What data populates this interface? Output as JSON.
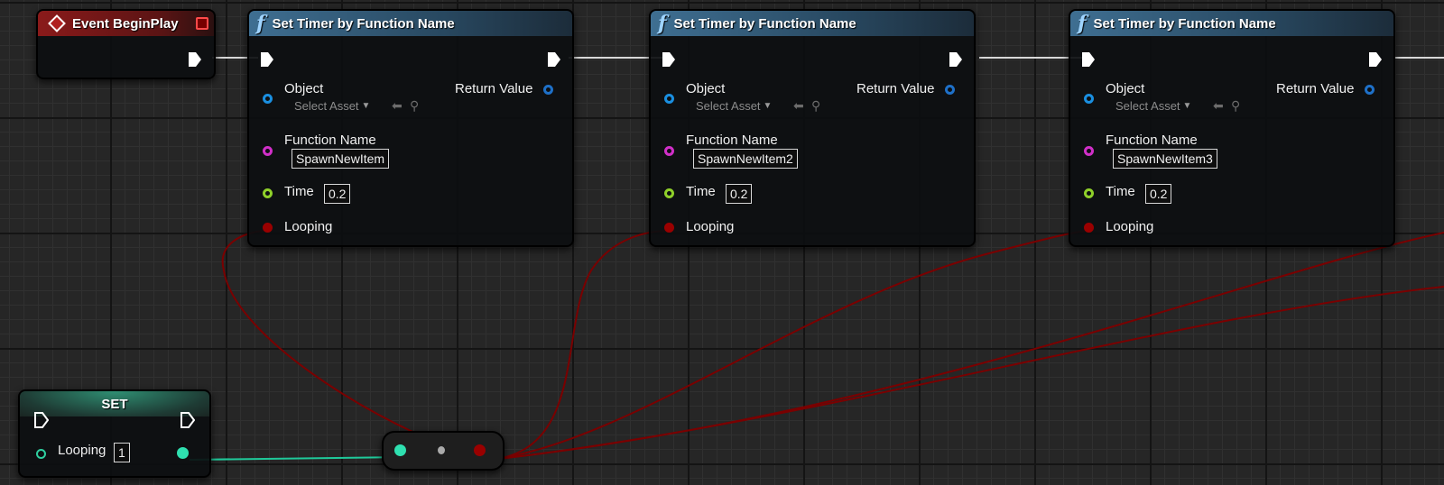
{
  "event_node": {
    "title": "Event BeginPlay"
  },
  "timer_nodes": [
    {
      "title": "Set Timer by Function Name",
      "object_label": "Object",
      "object_value": "Select Asset",
      "return_label": "Return Value",
      "function_label": "Function Name",
      "function_value": "SpawnNewItem",
      "time_label": "Time",
      "time_value": "0.2",
      "looping_label": "Looping"
    },
    {
      "title": "Set Timer by Function Name",
      "object_label": "Object",
      "object_value": "Select Asset",
      "return_label": "Return Value",
      "function_label": "Function Name",
      "function_value": "SpawnNewItem2",
      "time_label": "Time",
      "time_value": "0.2",
      "looping_label": "Looping"
    },
    {
      "title": "Set Timer by Function Name",
      "object_label": "Object",
      "object_value": "Select Asset",
      "return_label": "Return Value",
      "function_label": "Function Name",
      "function_value": "SpawnNewItem3",
      "time_label": "Time",
      "time_value": "0.2",
      "looping_label": "Looping"
    }
  ],
  "set_node": {
    "title": "SET",
    "variable_label": "Looping",
    "variable_value": "1"
  },
  "icons": {
    "function": "function-icon",
    "event": "event-icon",
    "exec": "exec-pin-icon",
    "browse": "browse-asset-icon",
    "search": "search-icon"
  },
  "colors": {
    "exec_wire": "#dddddd",
    "bool_wire": "#8a0000",
    "int_wire": "#1fc99a",
    "object_pin": "#1a8fe0",
    "name_pin": "#d02fc8",
    "float_pin": "#8fd02a"
  }
}
